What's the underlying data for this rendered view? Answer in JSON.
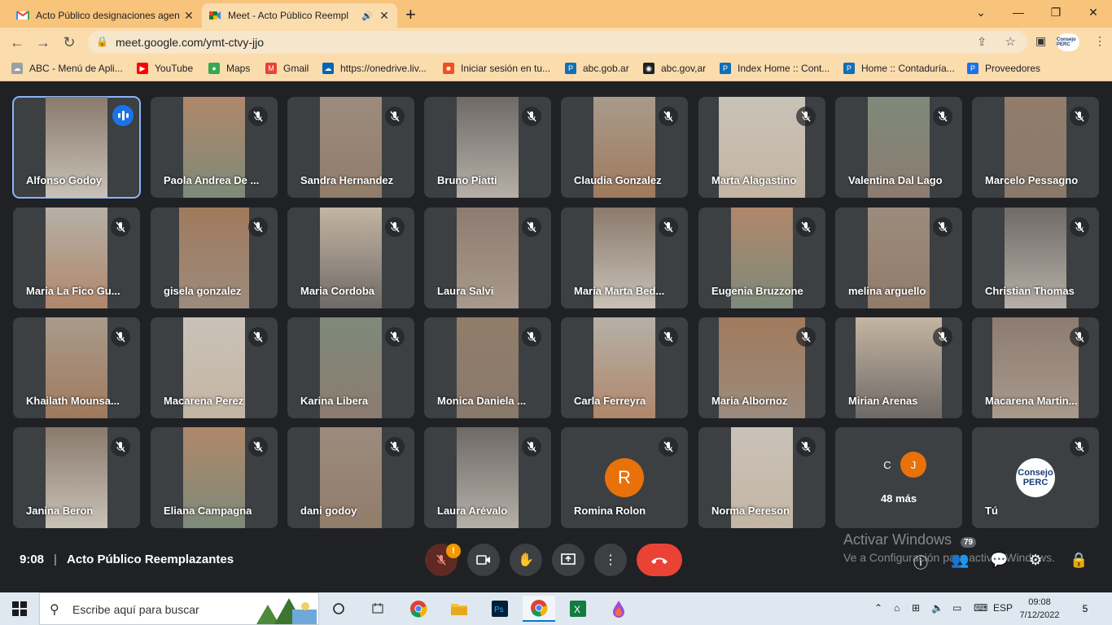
{
  "browser": {
    "tabs": [
      {
        "title": "Acto Público designaciones agen",
        "icon": "gmail-icon"
      },
      {
        "title": "Meet - Acto Público Reempl",
        "icon": "meet-icon",
        "audio": "speaker-icon"
      }
    ],
    "url": "meet.google.com/ymt-ctvy-jjo",
    "profile_label": "Consejo PERC",
    "bookmarks": [
      {
        "label": "ABC - Menú de Apli...",
        "icon": "cloud-icon",
        "color": "#9aa0a6"
      },
      {
        "label": "YouTube",
        "icon": "youtube-icon",
        "color": "#ff0000"
      },
      {
        "label": "Maps",
        "icon": "maps-icon",
        "color": "#34a853"
      },
      {
        "label": "Gmail",
        "icon": "gmail-icon",
        "color": "#ea4335"
      },
      {
        "label": "https://onedrive.liv...",
        "icon": "onedrive-icon",
        "color": "#0364b8"
      },
      {
        "label": "Iniciar sesión en tu...",
        "icon": "microsoft-icon",
        "color": "#f25022"
      },
      {
        "label": "abc.gob.ar",
        "icon": "p-icon",
        "color": "#0f6fb7"
      },
      {
        "label": "abc.gov,ar",
        "icon": "globe-icon",
        "color": "#202124"
      },
      {
        "label": "Index Home :: Cont...",
        "icon": "p-icon",
        "color": "#0f6fb7"
      },
      {
        "label": "Home :: Contaduría...",
        "icon": "p-icon",
        "color": "#0f6fb7"
      },
      {
        "label": "Proveedores",
        "icon": "p-circle-icon",
        "color": "#1a73e8"
      }
    ]
  },
  "meet": {
    "participants": [
      {
        "name": "Alfonso Godoy",
        "speaking": true
      },
      {
        "name": "Paola Andrea De ..."
      },
      {
        "name": "Sandra Hernandez"
      },
      {
        "name": "Bruno Piatti"
      },
      {
        "name": "Claudia Gonzalez"
      },
      {
        "name": "Marta Alagastino"
      },
      {
        "name": "Valentina Dal Lago"
      },
      {
        "name": "Marcelo Pessagno"
      },
      {
        "name": "Maria La Fico Gu..."
      },
      {
        "name": "gisela gonzalez"
      },
      {
        "name": "Maria Cordoba"
      },
      {
        "name": "Laura Salvi"
      },
      {
        "name": "Maria Marta Bed..."
      },
      {
        "name": "Eugenia Bruzzone"
      },
      {
        "name": "melina arguello"
      },
      {
        "name": "Christian Thomas"
      },
      {
        "name": "Khailath Mounsa..."
      },
      {
        "name": "Macarena Perez"
      },
      {
        "name": "Karina Libera"
      },
      {
        "name": "Monica Daniela ..."
      },
      {
        "name": "Carla Ferreyra"
      },
      {
        "name": "Maria Albornoz"
      },
      {
        "name": "Mirian Arenas"
      },
      {
        "name": "Macarena Martin..."
      },
      {
        "name": "Janina Beron"
      },
      {
        "name": "Eliana Campagna"
      },
      {
        "name": "dani godoy"
      },
      {
        "name": "Laura Arévalo"
      },
      {
        "name": "Romina Rolon",
        "avatar_letter": "R"
      },
      {
        "name": "Norma Pereson"
      }
    ],
    "more": {
      "label": "48 más",
      "avatars": [
        "C",
        "J"
      ]
    },
    "self": {
      "name": "Tú",
      "logo_line1": "Consejo",
      "logo_line2": "PERC"
    },
    "time": "9:08",
    "separator": "|",
    "meeting_title": "Acto Público Reemplazantes",
    "warning_badge": "!",
    "people_count": "79",
    "watermark_title": "Activar Windows",
    "watermark_sub": "Ve a Configuración para activar Windows."
  },
  "taskbar": {
    "search_placeholder": "Escribe aquí para buscar",
    "language": "ESP",
    "time": "09:08",
    "date": "7/12/2022",
    "notifications": "5"
  }
}
